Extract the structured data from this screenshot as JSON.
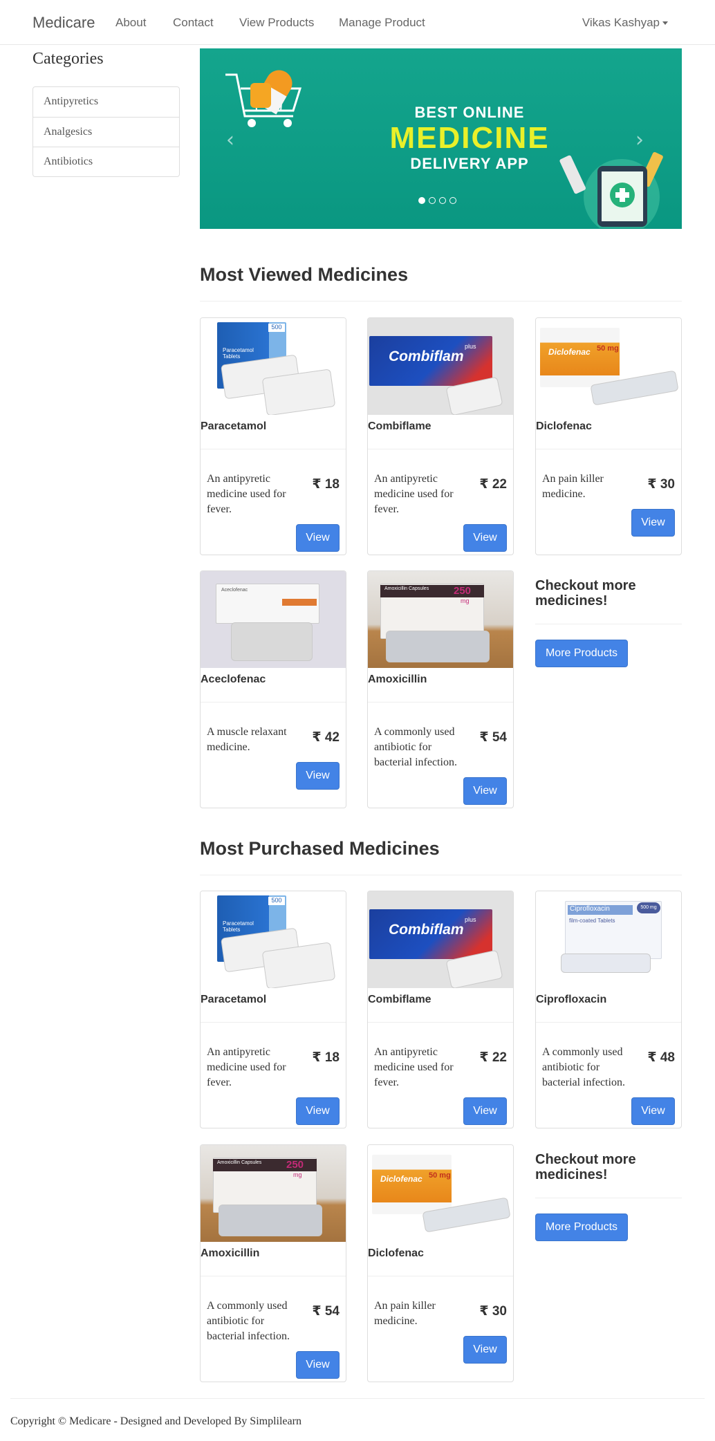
{
  "navbar": {
    "brand": "Medicare",
    "links": [
      "About",
      "Contact",
      "View Products",
      "Manage Product"
    ],
    "user": "Vikas Kashyap"
  },
  "sidebar": {
    "title": "Categories",
    "items": [
      "Antipyretics",
      "Analgesics",
      "Antibiotics"
    ]
  },
  "carousel": {
    "line1": "BEST ONLINE",
    "line2": "MEDICINE",
    "line3": "DELIVERY APP",
    "prev_icon": "‹",
    "next_icon": "›",
    "slide_count": 4,
    "active_slide": 1
  },
  "currency": "₹",
  "most_viewed": {
    "title": "Most Viewed Medicines",
    "products": [
      {
        "name": "Paracetamol",
        "description": "An antipyretic medicine used for fever.",
        "price": "18",
        "button": "View"
      },
      {
        "name": "Combiflame",
        "description": "An antipyretic medicine used for fever.",
        "price": "22",
        "button": "View"
      },
      {
        "name": "Diclofenac",
        "description": "An pain killer medicine.",
        "price": "30",
        "button": "View"
      },
      {
        "name": "Aceclofenac",
        "description": "A muscle relaxant medicine.",
        "price": "42",
        "button": "View"
      },
      {
        "name": "Amoxicillin",
        "description": "A commonly used antibiotic for bacterial infection.",
        "price": "54",
        "button": "View"
      }
    ],
    "checkout_title": "Checkout more medicines!",
    "more_button": "More Products"
  },
  "most_purchased": {
    "title": "Most Purchased Medicines",
    "products": [
      {
        "name": "Paracetamol",
        "description": "An antipyretic medicine used for fever.",
        "price": "18",
        "button": "View"
      },
      {
        "name": "Combiflame",
        "description": "An antipyretic medicine used for fever.",
        "price": "22",
        "button": "View"
      },
      {
        "name": "Ciprofloxacin",
        "description": "A commonly used antibiotic for bacterial infection.",
        "price": "48",
        "button": "View"
      },
      {
        "name": "Amoxicillin",
        "description": "A commonly used antibiotic for bacterial infection.",
        "price": "54",
        "button": "View"
      },
      {
        "name": "Diclofenac",
        "description": "An pain killer medicine.",
        "price": "30",
        "button": "View"
      }
    ],
    "checkout_title": "Checkout more medicines!",
    "more_button": "More Products"
  },
  "image_text": {
    "paracetamol_box": "Paracetamol Tablets",
    "paracetamol_strength": "500",
    "combiflam_box": "Combiflam",
    "combiflam_plus": "plus",
    "diclofenac_box": "Diclofenac",
    "diclofenac_strength": "50 mg",
    "aceclofenac_box": "Aceclofenac",
    "amoxicillin_box": "Amoxicillin Capsules",
    "amoxicillin_strength": "250",
    "amoxicillin_unit": "mg",
    "ciprofloxacin_box": "Ciprofloxacin",
    "ciprofloxacin_sub": "film-coated Tablets",
    "ciprofloxacin_strength": "500 mg"
  },
  "footer": {
    "text": "Copyright © Medicare - Designed and Developed By Simplilearn"
  },
  "colors": {
    "primary_button": "#4383e6",
    "carousel_bg": "#0a9781",
    "carousel_highlight": "#e9f02a"
  }
}
